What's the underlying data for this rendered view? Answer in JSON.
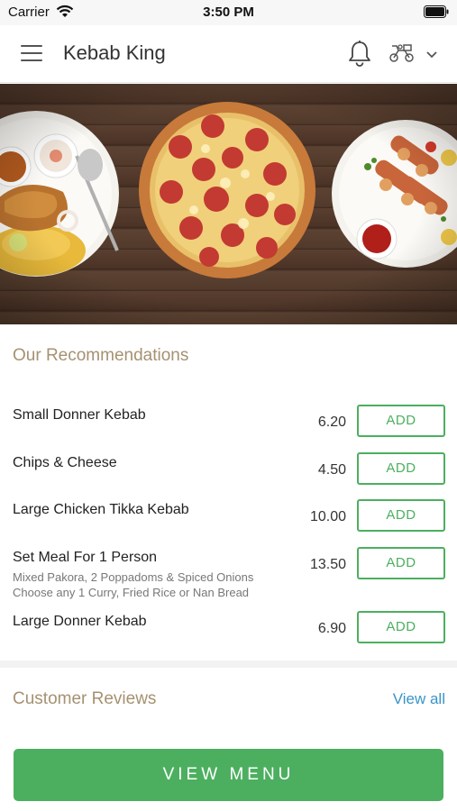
{
  "status_bar": {
    "carrier": "Carrier",
    "time": "3:50 PM"
  },
  "header": {
    "title": "Kebab King",
    "icons": [
      "hamburger-menu-icon",
      "bell-icon",
      "delivery-scooter-icon",
      "chevron-down-icon"
    ]
  },
  "hero": {
    "description_icons": [
      "curry-plate",
      "pizza",
      "kebab-plate"
    ]
  },
  "recommendations": {
    "heading": "Our Recommendations",
    "items": [
      {
        "name": "Small Donner Kebab",
        "description": "",
        "price": "6.20",
        "button": "ADD"
      },
      {
        "name": "Chips & Cheese",
        "description": "",
        "price": "4.50",
        "button": "ADD"
      },
      {
        "name": "Large Chicken Tikka Kebab",
        "description": "",
        "price": "10.00",
        "button": "ADD"
      },
      {
        "name": "Set Meal For 1 Person",
        "description_line1": "Mixed Pakora, 2 Poppadoms & Spiced Onions",
        "description_line2": "Choose any 1 Curry, Fried Rice or Nan Bread",
        "price": "13.50",
        "button": "ADD"
      },
      {
        "name": "Large Donner Kebab",
        "description": "",
        "price": "6.90",
        "button": "ADD"
      }
    ]
  },
  "reviews": {
    "heading": "Customer Reviews",
    "view_all": "View all"
  },
  "footer": {
    "view_menu": "VIEW MENU"
  },
  "colors": {
    "accent_green": "#4caf5f",
    "heading_tan": "#a69171",
    "link_blue": "#3a94c6"
  }
}
